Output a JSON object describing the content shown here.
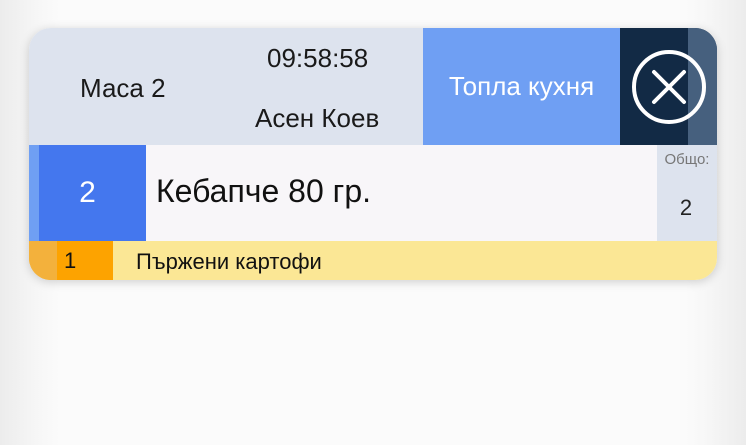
{
  "order": {
    "table": "Маса 2",
    "time": "09:58:58",
    "waiter": "Асен Коев",
    "station": "Топла кухня",
    "close_icon": "close-circle-icon"
  },
  "item": {
    "quantity": "2",
    "name": "Кебапче 80 гр.",
    "total_label": "Общо:",
    "total_value": "2"
  },
  "modifier": {
    "quantity": "1",
    "name": "Пържени картофи"
  },
  "colors": {
    "header_bg": "#dde3ee",
    "station_bg": "#6f9ff3",
    "close_bg": "#122a45",
    "qty_bg": "#4477ee",
    "modifier_bg": "#fbe795",
    "modifier_qty_bg": "#fda300"
  }
}
